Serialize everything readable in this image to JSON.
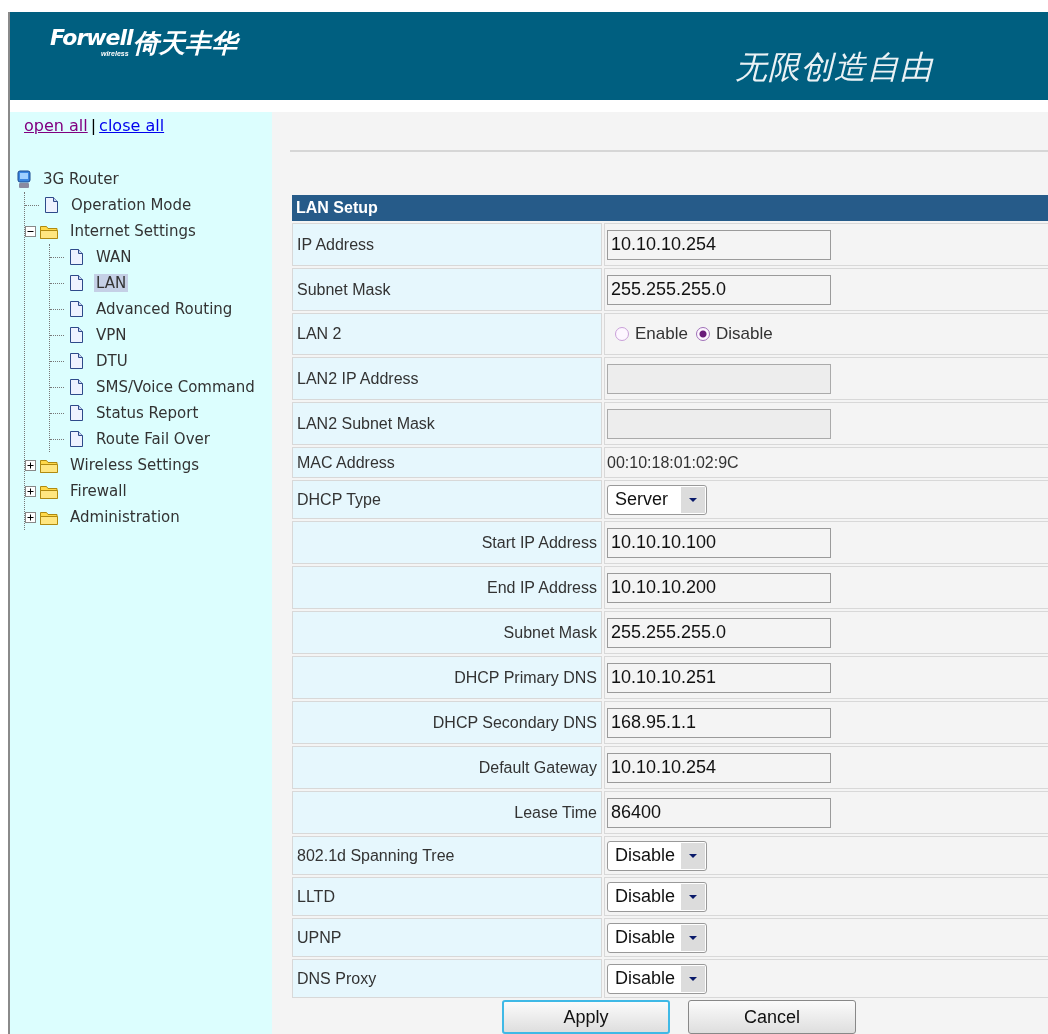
{
  "header": {
    "logo": "Forwell",
    "logo_sub": "wireless",
    "logo_cn": "倚天丰华",
    "slogan": "无限创造自由"
  },
  "sidebar": {
    "links": [
      {
        "label": "open all",
        "visited": true
      },
      {
        "label": "close all",
        "visited": false
      }
    ],
    "separator": "|",
    "tree": {
      "label": "3G Router",
      "kind": "root",
      "selected": false,
      "children": [
        {
          "label": "Operation Mode",
          "kind": "page",
          "selected": false
        },
        {
          "label": "Internet Settings",
          "kind": "folder",
          "expanded": true,
          "selected": false,
          "children": [
            {
              "label": "WAN",
              "kind": "page",
              "selected": false
            },
            {
              "label": "LAN",
              "kind": "page",
              "selected": true
            },
            {
              "label": "Advanced Routing",
              "kind": "page",
              "selected": false
            },
            {
              "label": "VPN",
              "kind": "page",
              "selected": false
            },
            {
              "label": "DTU",
              "kind": "page",
              "selected": false
            },
            {
              "label": "SMS/Voice Command",
              "kind": "page",
              "selected": false
            },
            {
              "label": "Status Report",
              "kind": "page",
              "selected": false
            },
            {
              "label": "Route Fail Over",
              "kind": "page",
              "selected": false
            }
          ]
        },
        {
          "label": "Wireless Settings",
          "kind": "folder",
          "expanded": false,
          "selected": false
        },
        {
          "label": "Firewall",
          "kind": "folder",
          "expanded": false,
          "selected": false
        },
        {
          "label": "Administration",
          "kind": "folder",
          "expanded": false,
          "selected": false
        }
      ]
    }
  },
  "form": {
    "title": "LAN Setup",
    "rows": [
      {
        "label": "IP Address",
        "kind": "input",
        "nested": false,
        "value": "10.10.10.254"
      },
      {
        "label": "Subnet Mask",
        "kind": "input",
        "nested": false,
        "value": "255.255.255.0"
      },
      {
        "label": "LAN 2",
        "kind": "radio",
        "nested": false,
        "options": [
          {
            "label": "Enable",
            "selected": false
          },
          {
            "label": "Disable",
            "selected": true
          }
        ]
      },
      {
        "label": "LAN2 IP Address",
        "kind": "input",
        "nested": false,
        "disabled": true
      },
      {
        "label": "LAN2 Subnet Mask",
        "kind": "input",
        "nested": false,
        "disabled": true
      },
      {
        "label": "MAC Address",
        "kind": "text",
        "nested": false,
        "value": "00:10:18:01:02:9C"
      },
      {
        "label": "DHCP Type",
        "kind": "select",
        "nested": false,
        "value": "Server"
      },
      {
        "label": "Start IP Address",
        "kind": "input",
        "nested": true,
        "value": "10.10.10.100"
      },
      {
        "label": "End IP Address",
        "kind": "input",
        "nested": true,
        "value": "10.10.10.200"
      },
      {
        "label": "Subnet Mask",
        "kind": "input",
        "nested": true,
        "value": "255.255.255.0"
      },
      {
        "label": "DHCP Primary DNS",
        "kind": "input",
        "nested": true,
        "value": "10.10.10.251"
      },
      {
        "label": "DHCP Secondary DNS",
        "kind": "input",
        "nested": true,
        "value": "168.95.1.1"
      },
      {
        "label": "Default Gateway",
        "kind": "input",
        "nested": true,
        "value": "10.10.10.254"
      },
      {
        "label": "Lease Time",
        "kind": "input",
        "nested": true,
        "value": "86400"
      },
      {
        "label": "802.1d Spanning Tree",
        "kind": "select",
        "nested": false,
        "value": "Disable"
      },
      {
        "label": "LLTD",
        "kind": "select",
        "nested": false,
        "value": "Disable"
      },
      {
        "label": "UPNP",
        "kind": "select",
        "nested": false,
        "value": "Disable"
      },
      {
        "label": "DNS Proxy",
        "kind": "select",
        "nested": false,
        "value": "Disable"
      }
    ]
  },
  "buttons": [
    {
      "label": "Apply",
      "focused": true
    },
    {
      "label": "Cancel",
      "focused": false
    }
  ]
}
